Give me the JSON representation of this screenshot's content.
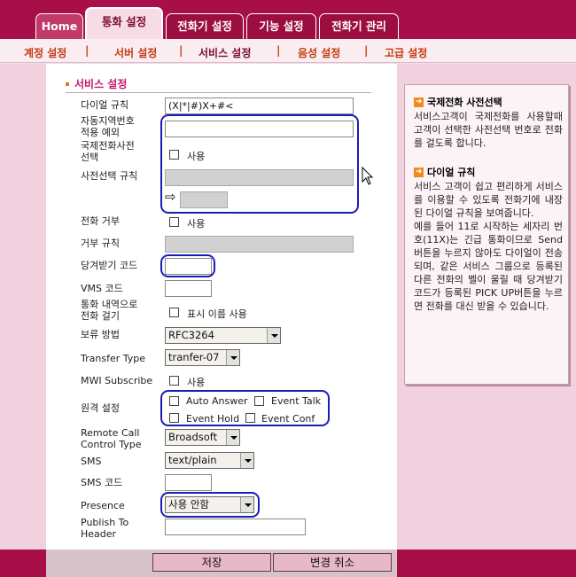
{
  "tabs": [
    "Home",
    "통화 설정",
    "전화기 설정",
    "기능 설정",
    "전화기 관리"
  ],
  "subnav": [
    "계정 설정",
    "서버 설정",
    "서비스 설정",
    "음성 설정",
    "고급 설정"
  ],
  "section_title": "서비스 설정",
  "fields": {
    "dial_rule_label": "다이얼 규칙",
    "dial_rule_value": "(X|*|#)X+#<",
    "area_code_label_1": "자동지역번호",
    "area_code_label_2": "적용 예외",
    "intl_label_1": "국제전화사전",
    "intl_label_2": "선택",
    "intl_cb": "사용",
    "prefix_label": "사전선택 규칙",
    "reject_label": "전화 거부",
    "reject_cb": "사용",
    "reject_rule_label": "거부 규칙",
    "pickup_label": "당겨받기 코드",
    "vms_label": "VMS 코드",
    "history_label_1": "통화 내역으로",
    "history_label_2": "전화 걸기",
    "history_cb": "표시 이름 사용",
    "hold_label": "보류 방법",
    "hold_value": "RFC3264",
    "transfer_label": "Transfer Type",
    "transfer_value": "tranfer-07",
    "mwi_label": "MWI Subscribe",
    "mwi_cb": "사용",
    "remote_label": "원격 설정",
    "remote_auto_answer": "Auto Answer",
    "remote_event_talk": "Event Talk",
    "remote_event_hold": "Event Hold",
    "remote_event_conf": "Event Conf",
    "rcc_label_1": "Remote Call",
    "rcc_label_2": "Control Type",
    "rcc_value": "Broadsoft",
    "sms_label": "SMS",
    "sms_value": "text/plain",
    "sms_code_label": "SMS 코드",
    "presence_label": "Presence",
    "presence_value": "사용 안함",
    "publish_label_1": "Publish To",
    "publish_label_2": "Header"
  },
  "help": {
    "title1": "국제전화 사전선택",
    "text1": "서비스고객이 국제전화를 사용할때 고객이 선택한 사전선택 번호로 전화를 걸도록 합니다.",
    "title2": "다이얼 규칙",
    "text2a": "서비스 고객이 쉽고 편리하게 서비스를 이용할 수 있도록 전화기에 내장된 다이얼 규칙을 보여줍니다.",
    "text2b": "예를 들어 11로 시작하는 세자리 번호(11X)는 긴급 통화이므로 Send 버튼을 누르지 않아도 다이얼이 전송되며, 같은 서비스 그룹으로 등록된 다른 전화의 벨이 울릴 때 당겨받기 코드가 등록된 PICK UP버튼을 누르면 전화를 대신 받을 수 있습니다."
  },
  "buttons": {
    "save": "저장",
    "cancel": "변경 취소"
  }
}
